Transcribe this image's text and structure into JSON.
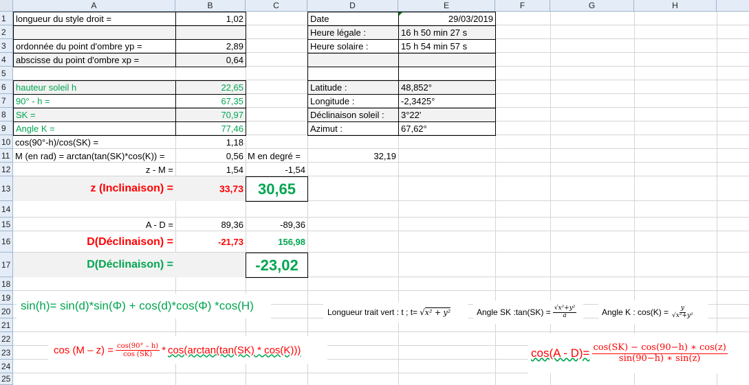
{
  "columns": [
    "A",
    "B",
    "C",
    "D",
    "E",
    "F",
    "G",
    "H"
  ],
  "rows": [
    "1",
    "2",
    "3",
    "4",
    "5",
    "6",
    "7",
    "8",
    "9",
    "10",
    "11",
    "12",
    "13",
    "14",
    "15",
    "16",
    "17",
    "18",
    "19",
    "20",
    "21",
    "22",
    "23",
    "24",
    "25"
  ],
  "cells": {
    "A1": "longueur du style droit =",
    "B1": "1,02",
    "A3": "ordonnée du point d'ombre yp =",
    "B3": "2,89",
    "A4": "abscisse du point d'ombre xp =",
    "B4": "0,64",
    "A6": "hauteur soleil h",
    "B6": "22,65",
    "A7": "90° - h =",
    "B7": "67,35",
    "A8": "SK  =",
    "B8": "70,97",
    "A9": "Angle K =",
    "B9": "77,46",
    "A10": "cos(90°-h)/cos(SK) =",
    "B10": "1,18",
    "A11": "M (en rad) = arctan(tan(SK)*cos(K)) =",
    "B11": "0,56",
    "C11": "M en degré =",
    "D11": "32,19",
    "A12": "z - M =",
    "B12": "1,54",
    "C12": "-1,54",
    "A13": "z (Inclinaison) =",
    "B13": "33,73",
    "C13": "30,65",
    "A15": "A - D =",
    "B15": "89,36",
    "C15": "-89,36",
    "A16": "D(Déclinaison) =",
    "B16": "-21,73",
    "C16": "156,98",
    "A17": "D(Déclinaison) =",
    "C17": "-23,02",
    "D1": "Date",
    "E1": "29/03/2019",
    "D2": "Heure légale :",
    "E2": "16 h 50 min 27 s",
    "D3": "Heure solaire :",
    "E3": "15 h 54 min 57 s",
    "D6": "Latitude :",
    "E6": "48,852°",
    "D7": "Longitude :",
    "E7": "-2,3425°",
    "D8": "Déclinaison soleil :",
    "E8": "3°22'",
    "D9": "Azimut :",
    "E9": "67,62°"
  },
  "formulas": {
    "sinh": "sin(h)= sin(d)*sin(Φ) + cos(d)*cos(Φ) *cos(H)",
    "trait_label": "Longueur trait vert : t ; t=",
    "trait_expr": "x² + y²",
    "sk_label": "Angle SK :tan(SK) =",
    "sk_num": "x²+y²",
    "sk_den": "a",
    "k_label": "Angle K : cos(K) =",
    "k_num": "y",
    "k_den": "x²+y²",
    "cosmz_left": "cos (M – z) =",
    "cosmz_num": "cos(90° – h)",
    "cosmz_den": "cos (SK)",
    "cosmz_right": "cos(arctan(tan(SK) * cos(K)))",
    "cosad_left": "cos(A - D)=",
    "cosad_num": "cos(SK) − cos(90−h) ∗ cos(z)",
    "cosad_den": "sin(90−h) ∗ sin(z)"
  },
  "colors": {
    "header_bg": "#e4ecf7",
    "green": "#00a550",
    "red": "#ff0000",
    "grid": "#d4d4d4"
  }
}
